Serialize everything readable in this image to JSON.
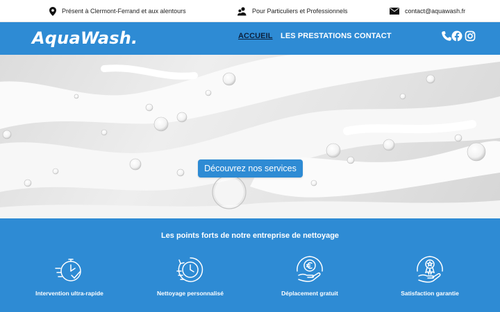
{
  "topbar": {
    "location": {
      "icon": "location-pin-icon",
      "text": "Présent à Clermont-Ferrand et aux alentours"
    },
    "clients": {
      "icon": "users-icon",
      "text": "Pour Particuliers et Professionnels"
    },
    "email": {
      "icon": "envelope-icon",
      "text": "contact@aquawash.fr"
    }
  },
  "header": {
    "logo": "AquaWash.",
    "nav": [
      {
        "label": "ACCUEIL",
        "active": true
      },
      {
        "label": "LES PRESTATIONS",
        "active": false
      },
      {
        "label": "CONTACT",
        "active": false
      }
    ],
    "social": [
      "phone-icon",
      "facebook-icon",
      "instagram-icon"
    ]
  },
  "hero": {
    "cta_label": "Découvrez nos services"
  },
  "features": {
    "title": "Les points forts de notre entreprise de nettoyage",
    "items": [
      {
        "icon": "fast-stopwatch-icon",
        "label": "Intervention ultra-rapide"
      },
      {
        "icon": "custom-clock-icon",
        "label": "Nettoyage personnalisé"
      },
      {
        "icon": "euro-hand-icon",
        "label": "Déplacement gratuit"
      },
      {
        "icon": "award-hand-icon",
        "label": "Satisfaction garantie"
      }
    ]
  },
  "colors": {
    "brand_blue": "#2e8bd4",
    "active_nav": "#0c1f3b",
    "white": "#ffffff"
  }
}
